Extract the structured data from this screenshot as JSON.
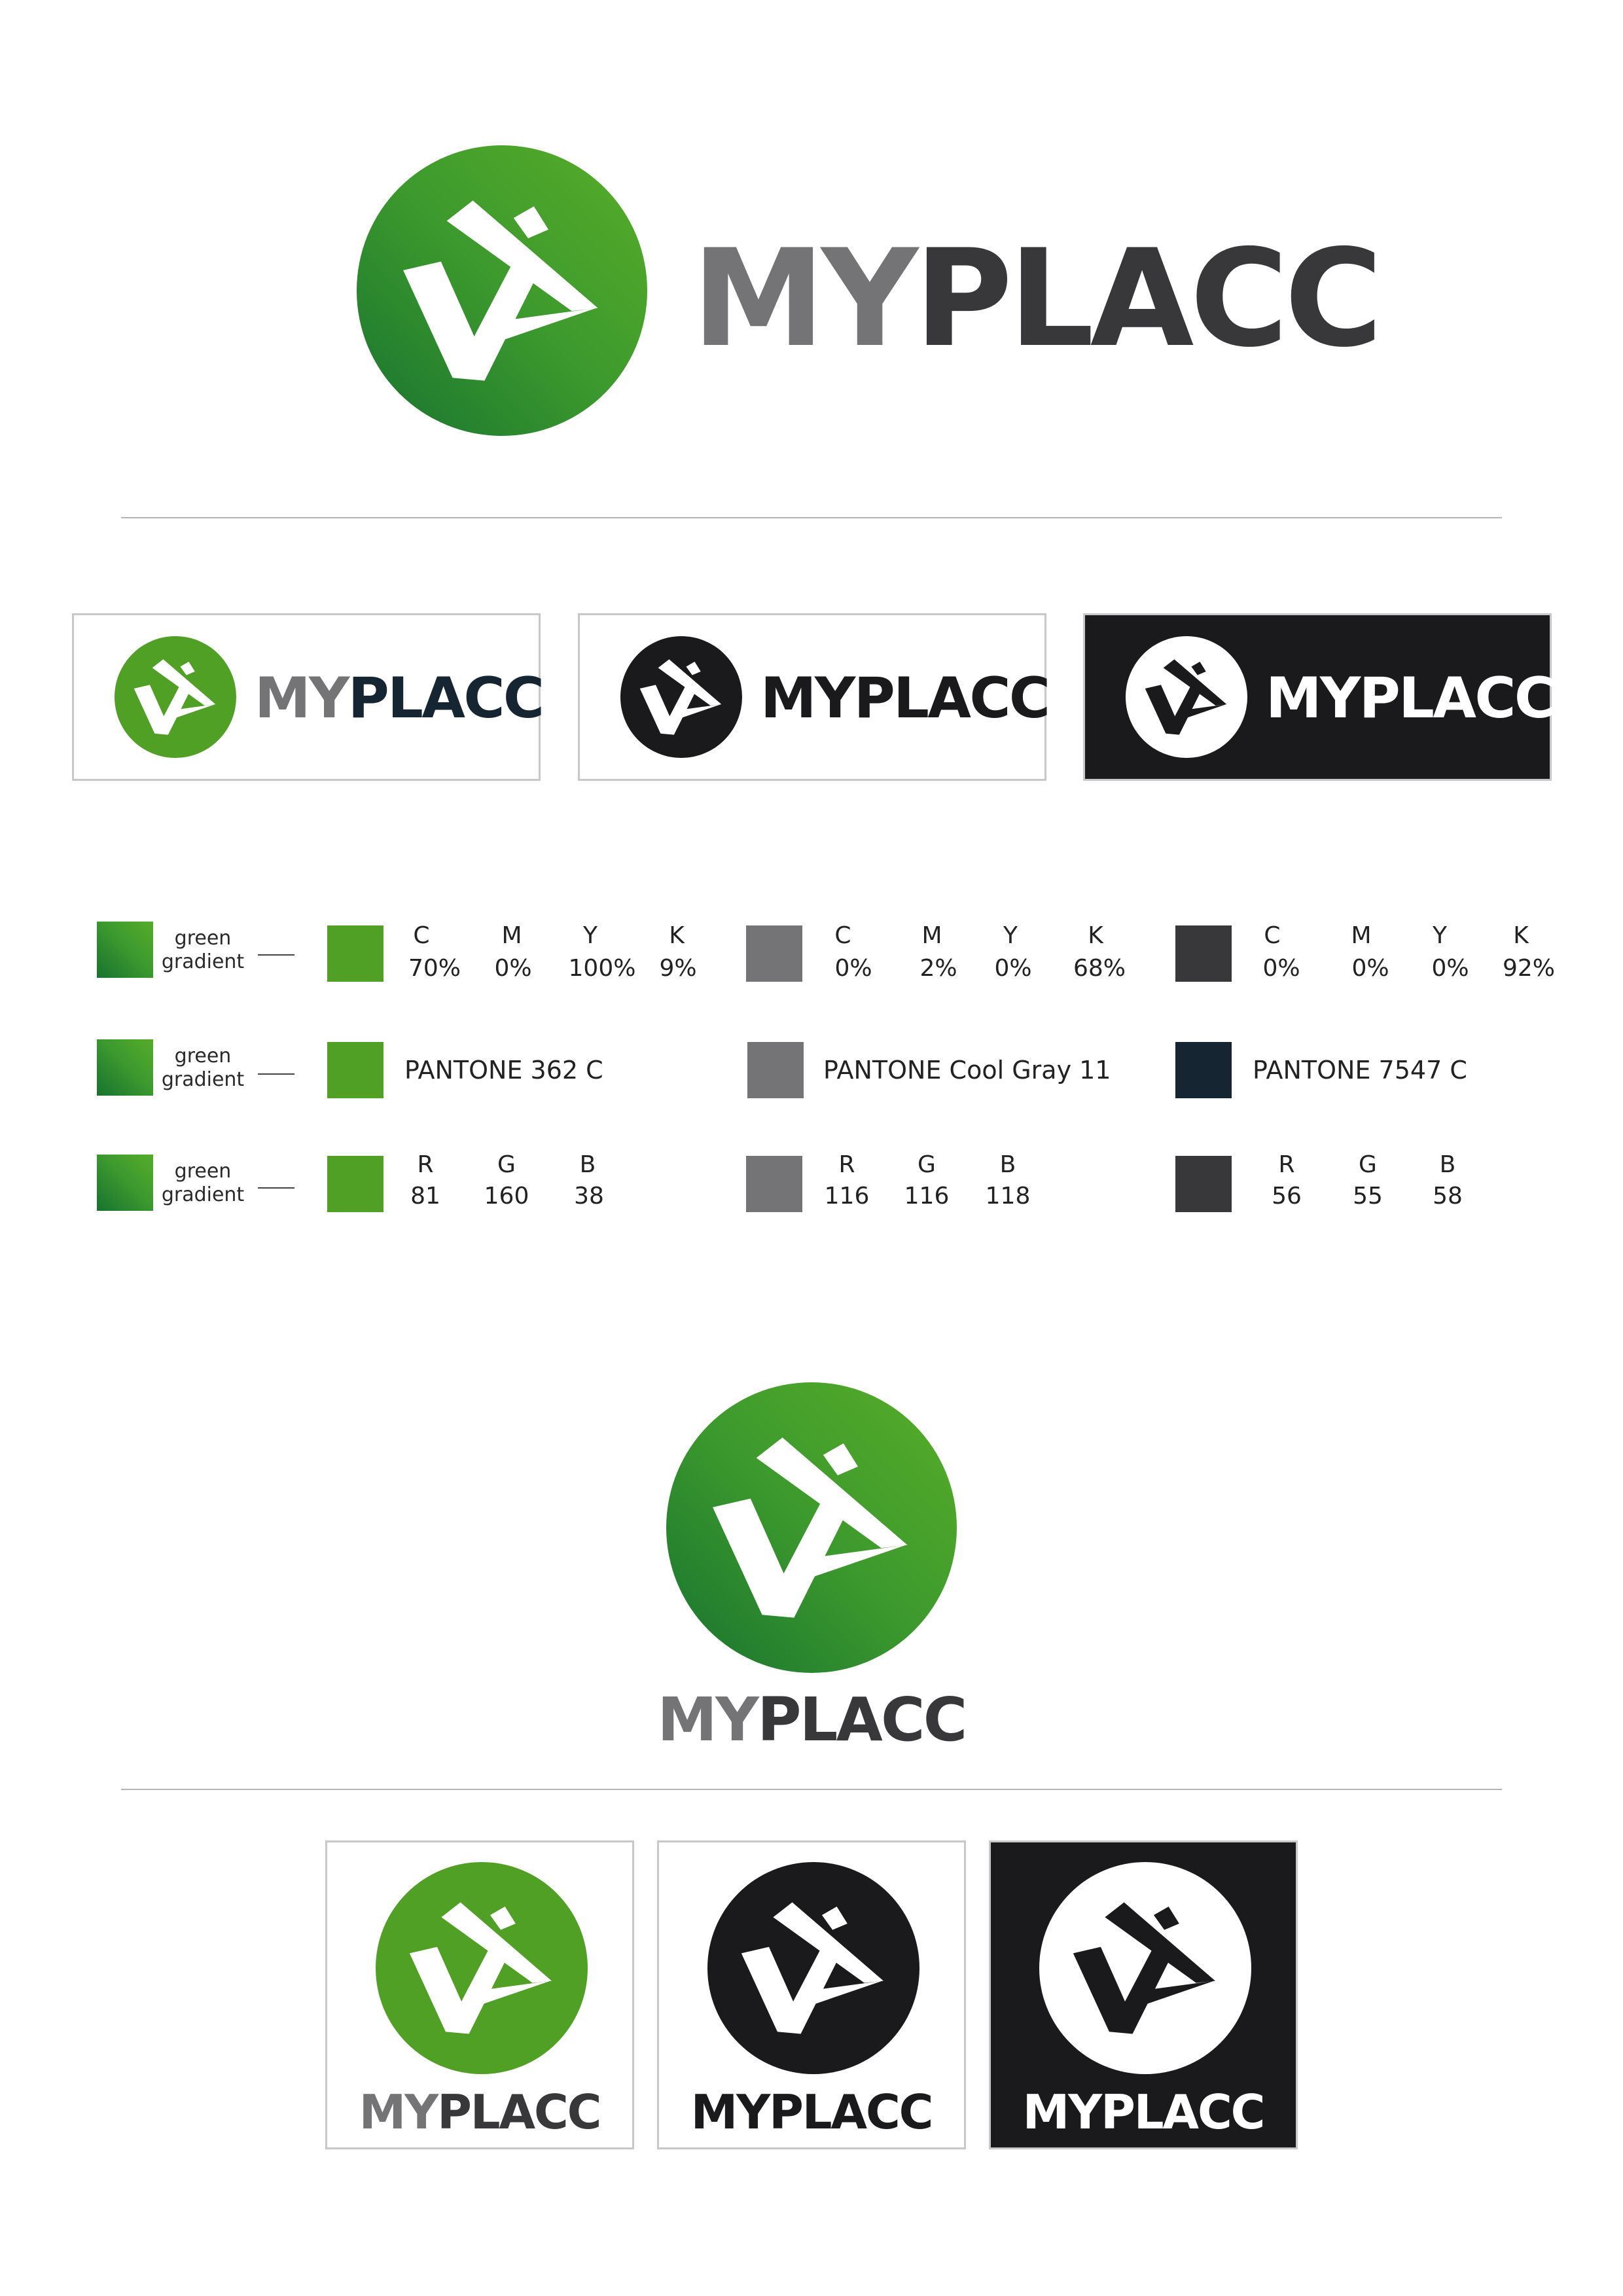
{
  "brand": {
    "word_light": "MY",
    "word_dark": "PLACC",
    "logo_name": "myplacc-play-check-mark"
  },
  "colors": {
    "green": "#51A026",
    "green_gradient_dark": "#17732E",
    "gray": "#747476",
    "dark": "#38373A",
    "navy": "#162532",
    "black_panel": "#1A1A1C"
  },
  "swatch_rows": [
    {
      "caption_line1": "green",
      "caption_line2": "gradient",
      "green": {
        "labels": [
          "C",
          "M",
          "Y",
          "K"
        ],
        "values": [
          "70%",
          "0%",
          "100%",
          "9%"
        ]
      },
      "gray": {
        "labels": [
          "C",
          "M",
          "Y",
          "K"
        ],
        "values": [
          "0%",
          "2%",
          "0%",
          "68%"
        ]
      },
      "dark": {
        "labels": [
          "C",
          "M",
          "Y",
          "K"
        ],
        "values": [
          "0%",
          "0%",
          "0%",
          "92%"
        ]
      }
    },
    {
      "caption_line1": "green",
      "caption_line2": "gradient",
      "green": {
        "pantone": "PANTONE 362 C"
      },
      "gray": {
        "pantone": "PANTONE Cool Gray 11"
      },
      "dark": {
        "pantone": "PANTONE 7547 C"
      }
    },
    {
      "caption_line1": "green",
      "caption_line2": "gradient",
      "green": {
        "labels": [
          "R",
          "G",
          "B"
        ],
        "values": [
          "81",
          "160",
          "38"
        ]
      },
      "gray": {
        "labels": [
          "R",
          "G",
          "B"
        ],
        "values": [
          "116",
          "116",
          "118"
        ]
      },
      "dark": {
        "labels": [
          "R",
          "G",
          "B"
        ],
        "values": [
          "56",
          "55",
          "58"
        ]
      }
    }
  ]
}
